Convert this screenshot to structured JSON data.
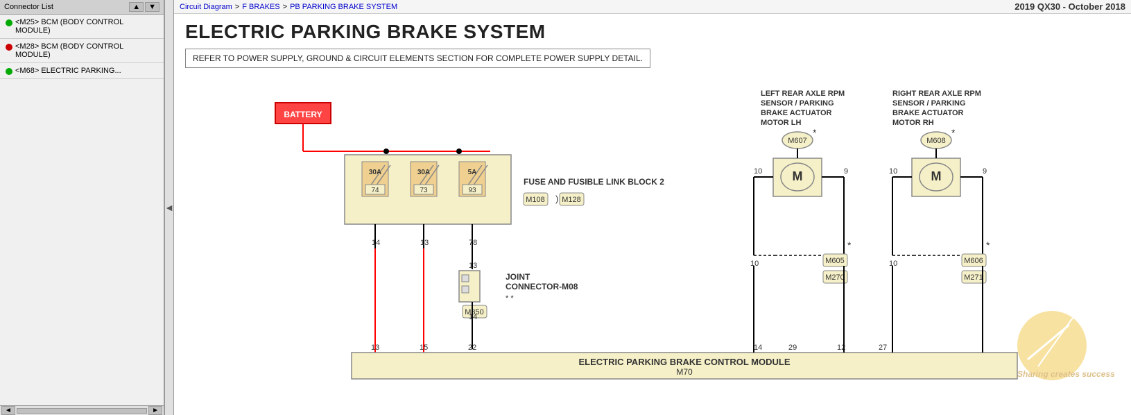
{
  "leftPanel": {
    "header": "Connector List",
    "items": [
      {
        "label": "<M25> BCM (BODY CONTROL MODULE)",
        "dot": "green"
      },
      {
        "label": "<M28> BCM (BODY CONTROL MODULE)",
        "dot": "red"
      },
      {
        "label": "<M68> ELECTRIC PARKING...",
        "dot": "green"
      }
    ]
  },
  "collapseBtn": "◄",
  "topBar": {
    "breadcrumb": {
      "circuitDiagram": "Circuit Diagram",
      "arrow": ">",
      "fBrakes": "F BRAKES",
      "arrow2": ">",
      "pbParking": "PB PARKING BRAKE SYSTEM"
    },
    "vehicleInfo": "2019 QX30 - October 2018"
  },
  "diagram": {
    "title": "ELECTRIC PARKING BRAKE SYSTEM",
    "note": "REFER TO POWER SUPPLY, GROUND & CIRCUIT ELEMENTS SECTION FOR COMPLETE POWER SUPPLY DETAIL.",
    "labels": {
      "battery": "BATTERY",
      "fuseBlock": "FUSE AND FUSIBLE LINK BLOCK 2",
      "fuse30a74": "30A\n74",
      "fuse30a73": "30A\n73",
      "fuse5a93": "5A\n93",
      "m108": "M108",
      "m128": "M128",
      "jointConnector": "JOINT\nCONNECTOR-M08",
      "m350": "M350",
      "leftSensorLabel": "LEFT REAR AXLE RPM\nSENSOR / PARKING\nBRAKE ACTUATOR\nMOTOR LH",
      "rightSensorLabel": "RIGHT REAR AXLE RPM\nSENSOR / PARKING\nBRAKE ACTUATOR\nMOTOR RH",
      "m607": "M607",
      "m608": "M608",
      "m605": "M605",
      "m270": "M270",
      "m606": "M606",
      "m271": "M271",
      "controlModule": "ELECTRIC PARKING BRAKE CONTROL MODULE",
      "m70": "M70",
      "pin14": "14",
      "pin13_fuse": "13",
      "pin78": "78",
      "pin13_jc": "13",
      "pin14_jc": "14",
      "pin13_mod": "13",
      "pin15_mod": "15",
      "pin22_mod": "22",
      "pin10_lh1": "10",
      "pin9_lh1": "9",
      "pin10_lh2": "10",
      "pin9_lh2": "9",
      "pin14_mod2": "14",
      "pin29_mod2": "29",
      "pin12_mod2": "12",
      "pin27_mod2": "27",
      "motorM_lh": "M",
      "motorM_rh": "M"
    }
  },
  "watermark": {
    "text": "Sharing creates success"
  }
}
